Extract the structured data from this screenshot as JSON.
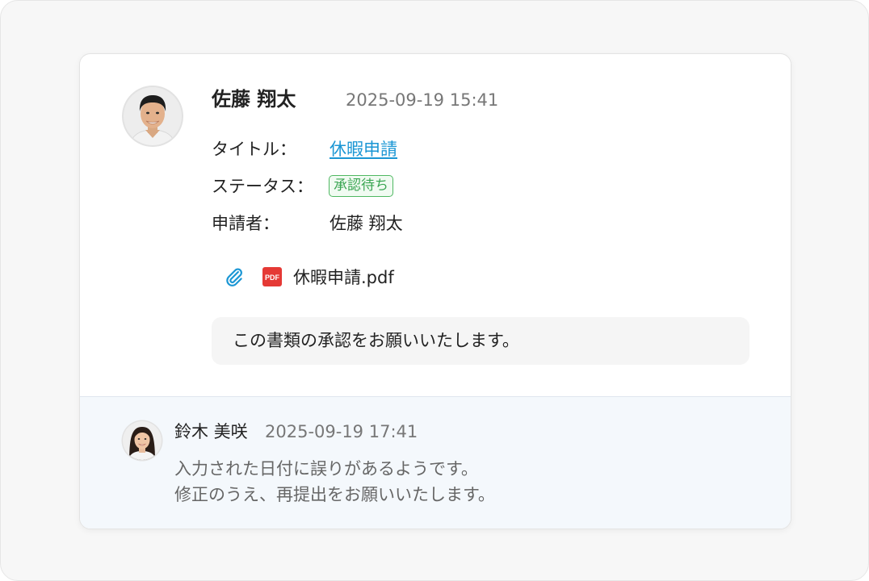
{
  "post": {
    "author": "佐藤 翔太",
    "timestamp": "2025-09-19 15:41",
    "fields": {
      "title_label": "タイトル：",
      "title_value": "休暇申請",
      "status_label": "ステータス：",
      "status_value": "承認待ち",
      "applicant_label": "申請者：",
      "applicant_value": "佐藤 翔太"
    },
    "attachment": {
      "icon": "paperclip-icon",
      "file_icon": "pdf-icon",
      "file_icon_text": "PDF",
      "file_name": "休暇申請.pdf"
    },
    "message": "この書類の承認をお願いいたします。"
  },
  "reply": {
    "author": "鈴木 美咲",
    "timestamp": "2025-09-19 17:41",
    "lines": [
      "入力された日付に誤りがあるようです。",
      "修正のうえ、再提出をお願いいたします。"
    ]
  },
  "colors": {
    "link": "#1a96d4",
    "status_green": "#3ba653",
    "pdf_red": "#e53935",
    "clip_blue": "#1a96d4",
    "reply_bg": "#f4f8fc"
  }
}
